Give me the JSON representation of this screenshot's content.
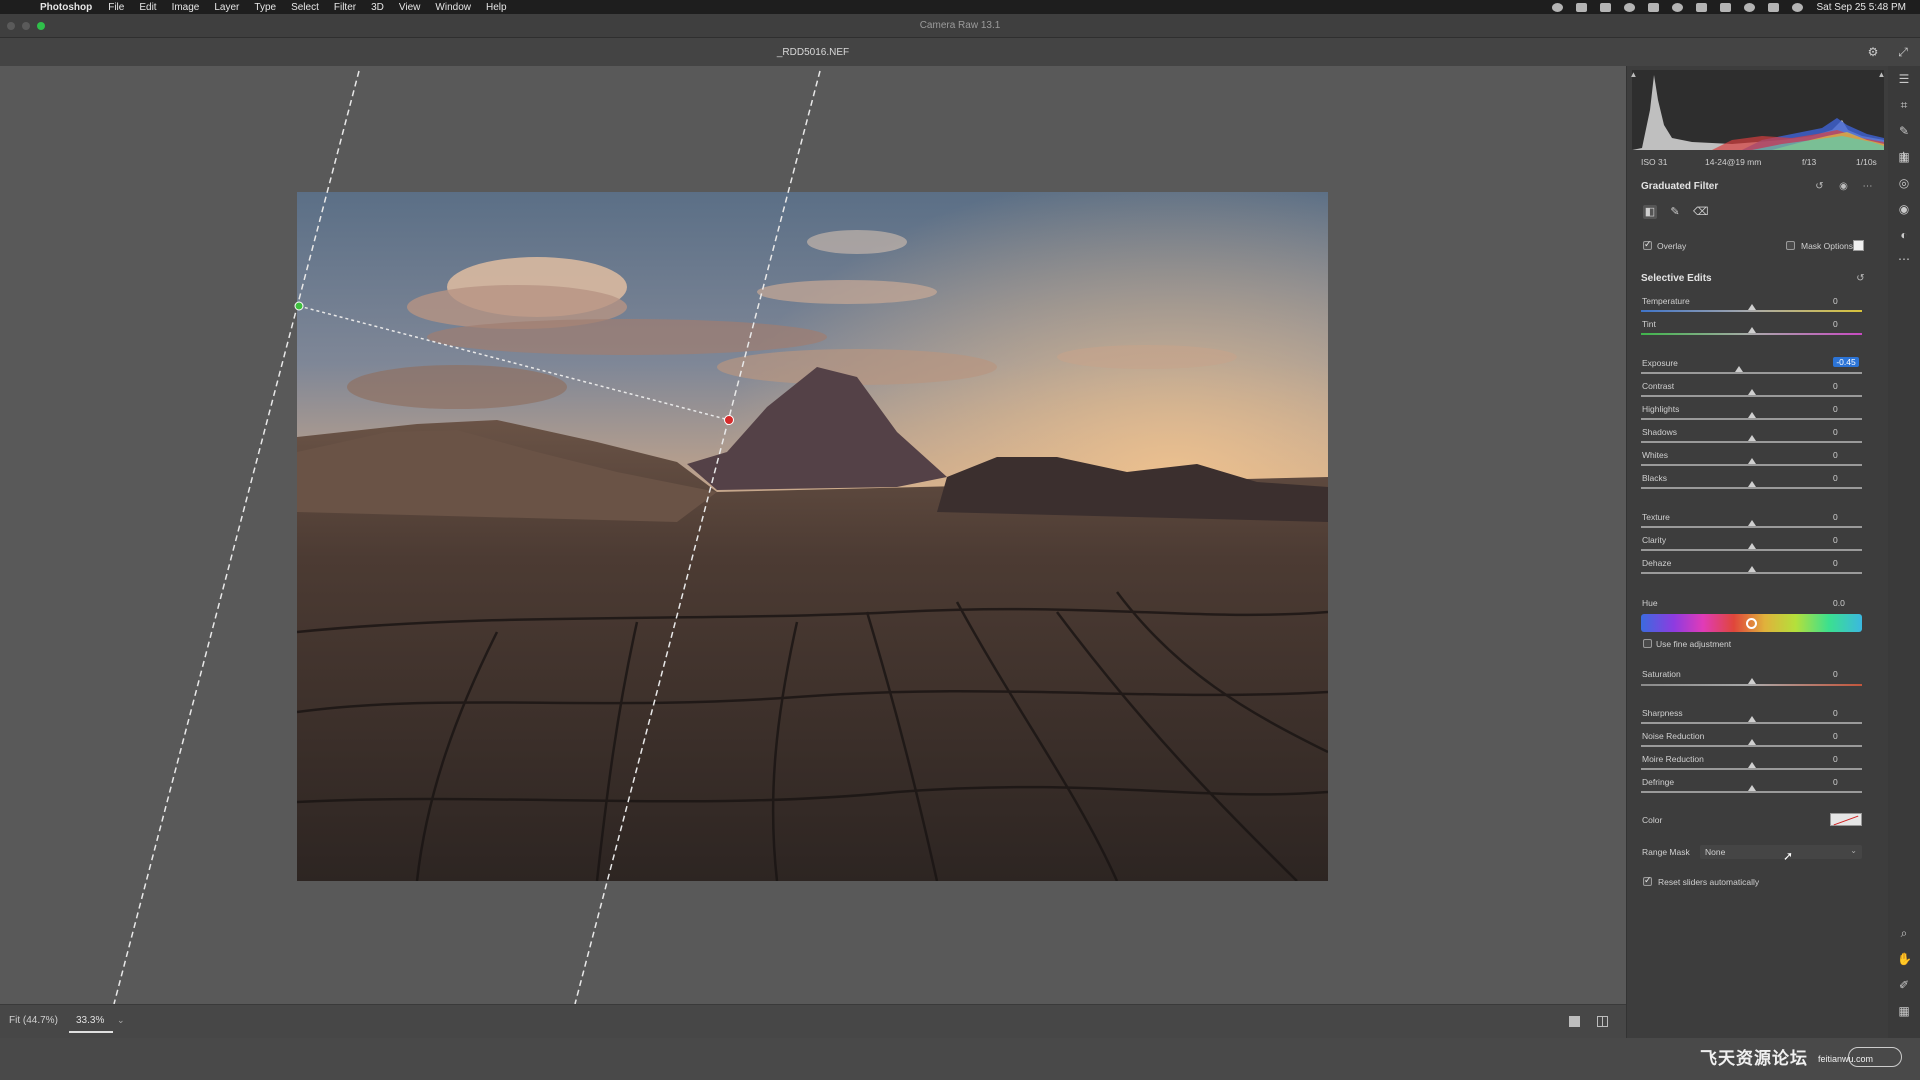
{
  "menubar": {
    "app_name": "Photoshop",
    "items": [
      "File",
      "Edit",
      "Image",
      "Layer",
      "Type",
      "Select",
      "Filter",
      "3D",
      "View",
      "Window",
      "Help"
    ],
    "clock": "Sat Sep 25  5:48 PM"
  },
  "window": {
    "title": "Camera Raw 13.1"
  },
  "document": {
    "filename": "_RDD5016.NEF"
  },
  "histogram": {
    "iso": "ISO 31",
    "lens": "14-24@19 mm",
    "aperture": "f/13",
    "shutter": "1/10s"
  },
  "filter_panel": {
    "title": "Graduated Filter",
    "overlay_label": "Overlay",
    "overlay_checked": true,
    "mask_options_label": "Mask Options",
    "selective_title": "Selective Edits",
    "sliders_group1": [
      {
        "label": "Temperature",
        "value": "0",
        "position": 0.5
      },
      {
        "label": "Tint",
        "value": "0",
        "position": 0.5
      }
    ],
    "sliders_group2": [
      {
        "label": "Exposure",
        "value": "-0.45",
        "position": 0.445
      },
      {
        "label": "Contrast",
        "value": "0",
        "position": 0.5
      },
      {
        "label": "Highlights",
        "value": "0",
        "position": 0.5
      },
      {
        "label": "Shadows",
        "value": "0",
        "position": 0.5
      },
      {
        "label": "Whites",
        "value": "0",
        "position": 0.5
      },
      {
        "label": "Blacks",
        "value": "0",
        "position": 0.5
      }
    ],
    "sliders_group3": [
      {
        "label": "Texture",
        "value": "0",
        "position": 0.5
      },
      {
        "label": "Clarity",
        "value": "0",
        "position": 0.5
      },
      {
        "label": "Dehaze",
        "value": "0",
        "position": 0.5
      }
    ],
    "hue": {
      "label": "Hue",
      "value": "0.0",
      "position": 0.5
    },
    "fine_adjust_label": "Use fine adjustment",
    "saturation": {
      "label": "Saturation",
      "value": "0",
      "position": 0.5
    },
    "sliders_group4": [
      {
        "label": "Sharpness",
        "value": "0",
        "position": 0.5
      },
      {
        "label": "Noise Reduction",
        "value": "0",
        "position": 0.5
      },
      {
        "label": "Moire Reduction",
        "value": "0",
        "position": 0.5
      },
      {
        "label": "Defringe",
        "value": "0",
        "position": 0.5
      }
    ],
    "color_label": "Color",
    "range_mask_label": "Range Mask",
    "range_mask_value": "None",
    "reset_label": "Reset sliders automatically",
    "reset_checked": true
  },
  "bottombar": {
    "fit_label": "Fit (44.7%)",
    "zoom_value": "33.3%"
  },
  "watermark": {
    "text": "飞天资源论坛",
    "sub": "feitianwu.com"
  }
}
